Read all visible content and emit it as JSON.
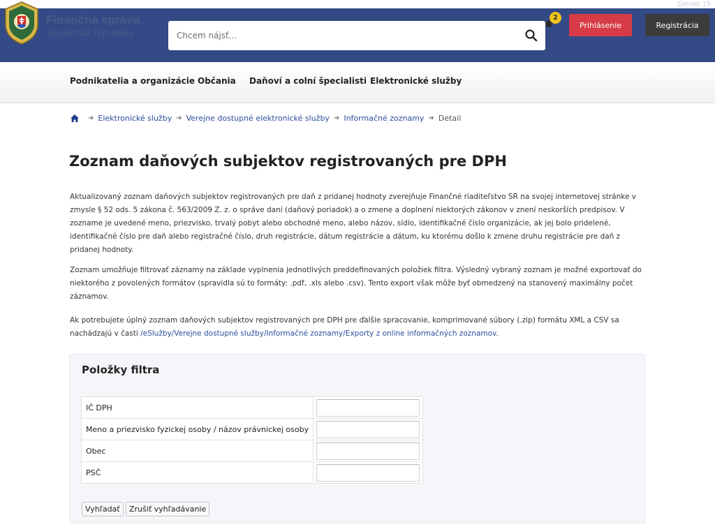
{
  "header": {
    "server_label": "Server 15",
    "brand_title": "Finančná správa",
    "brand_subtitle": "Slovenská republika",
    "search_placeholder": "Chcem nájsť...",
    "notification_count": "2",
    "login_label": "Prihlásenie",
    "register_label": "Registrácia"
  },
  "nav": {
    "items": [
      {
        "label": "Podnikatelia a organizácie"
      },
      {
        "label": "Občania"
      },
      {
        "label": "Daňoví a colní špecialisti"
      },
      {
        "label": "Elektronické služby"
      }
    ]
  },
  "breadcrumb": {
    "items": [
      {
        "label": "Elektronické služby"
      },
      {
        "label": "Verejne dostupné elektronické služby"
      },
      {
        "label": "Informačné zoznamy"
      }
    ],
    "current": "Detail"
  },
  "page": {
    "title": "Zoznam daňových subjektov registrovaných pre DPH",
    "para1": "Aktualizovaný zoznam daňových subjektov registrovaných pre daň z pridanej hodnoty zverejňuje Finančné riaditeľstvo SR na svojej internetovej stránke v zmysle § 52 ods. 5 zákona č. 563/2009 Z. z. o správe daní (daňový poriadok) a o zmene a doplnení niektorých zákonov v znení neskorších predpisov. V zozname je uvedené meno, priezvisko, trvalý pobyt alebo obchodné meno, alebo názov, sídlo, identifikačné číslo organizácie, ak jej bolo pridelené, identifikačné číslo pre daň alebo registračné číslo, druh registrácie, dátum registrácie a dátum, ku ktorému došlo k zmene druhu registrácie pre daň z pridanej hodnoty.",
    "para2": "Zoznam umožňuje filtrovať záznamy na základe vyplnenia jednotlivých preddefinovaných položiek filtra. Výsledný vybraný zoznam je možné exportovať do niektorého z povolených formátov (spravidla sú to formáty: .pdf, .xls alebo .csv). Tento export však môže byť obmedzený na stanovený maximálny počet záznamov.",
    "para3_text": "Ak potrebujete úplný zoznam daňových subjektov registrovaných pre DPH pre ďalšie spracovanie, komprimované súbory (.zip) formátu XML a CSV sa nachádzajú v časti ",
    "para3_link": "/eSlužby/Verejne dostupné služby/Informačné zoznamy/Exporty z online informačných zoznamov",
    "para3_end": "."
  },
  "filter": {
    "heading": "Položky filtra",
    "fields": [
      {
        "label": "IČ DPH",
        "value": ""
      },
      {
        "label": "Meno a priezvisko fyzickej osoby / názov právnickej osoby",
        "value": ""
      },
      {
        "label": "Obec",
        "value": ""
      },
      {
        "label": "PSČ",
        "value": ""
      }
    ],
    "search_button": "Vyhľadať",
    "reset_button": "Zrušiť vyhľadávanie"
  },
  "colors": {
    "header_bg": "#334a86",
    "login_bg": "#d63b46",
    "register_bg": "#3c3c3c",
    "link": "#2b4e9c",
    "badge": "#f0c419"
  }
}
